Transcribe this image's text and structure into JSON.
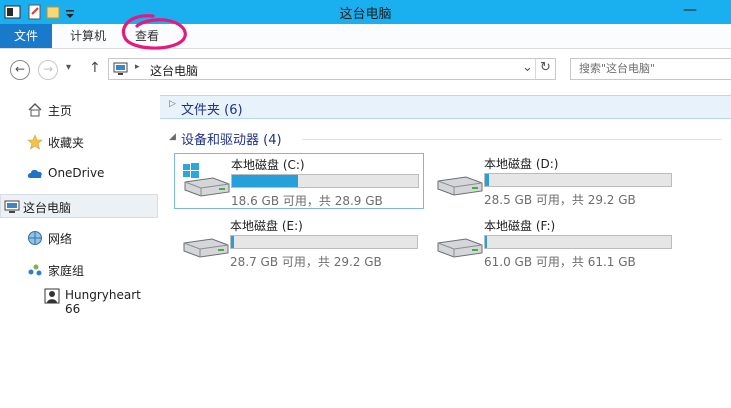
{
  "window": {
    "title": "这台电脑",
    "minimize_glyph": "—"
  },
  "ribbon": {
    "file": "文件",
    "computer": "计算机",
    "view": "查看"
  },
  "address": {
    "path": "这台电脑",
    "separator": "▸",
    "dropdown_glyph": "⌄",
    "refresh_glyph": "↻"
  },
  "search": {
    "placeholder": "搜索\"这台电脑\""
  },
  "nav": {
    "back_glyph": "←",
    "forward_glyph": "→",
    "recent_glyph": "▾",
    "up_glyph": "↑"
  },
  "sidebar": {
    "items": [
      {
        "label": "主页",
        "icon": "home-icon"
      },
      {
        "label": "收藏夹",
        "icon": "star-icon"
      },
      {
        "label": "OneDrive",
        "icon": "cloud-icon"
      },
      {
        "label": "这台电脑",
        "icon": "computer-icon",
        "selected": true
      },
      {
        "label": "网络",
        "icon": "network-icon"
      },
      {
        "label": "家庭组",
        "icon": "homegroup-icon"
      },
      {
        "label": "Hungryheart 66",
        "icon": "user-icon"
      }
    ]
  },
  "groups": {
    "folders": "文件夹 (6)",
    "drives": "设备和驱动器 (4)"
  },
  "drives": [
    {
      "name": "本地磁盘 (C:)",
      "free": "18.6 GB 可用，共 28.9 GB",
      "used_fraction": 0.356,
      "system": true,
      "selected": true
    },
    {
      "name": "本地磁盘 (D:)",
      "free": "28.5 GB 可用，共 29.2 GB",
      "used_fraction": 0.024,
      "system": false
    },
    {
      "name": "本地磁盘 (E:)",
      "free": "28.7 GB 可用，共 29.2 GB",
      "used_fraction": 0.017,
      "system": false
    },
    {
      "name": "本地磁盘 (F:)",
      "free": "61.0 GB 可用，共 61.1 GB",
      "used_fraction": 0.012,
      "system": false
    }
  ],
  "colors": {
    "titlebar": "#1ab0f0",
    "file_tab": "#1979ca",
    "group_header": "#1e3287",
    "progress": "#26a0da",
    "annotation": "#e6197f"
  }
}
